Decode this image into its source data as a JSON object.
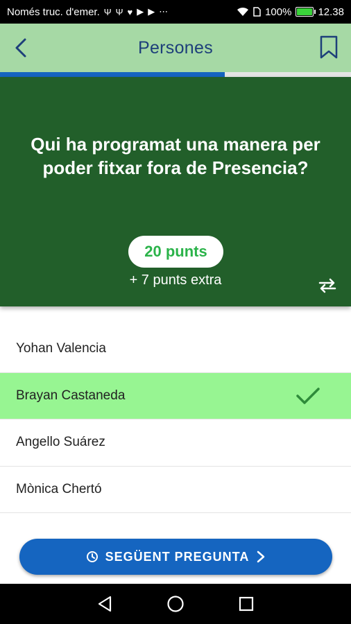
{
  "status_bar": {
    "left_text": "Només truc. d'emer.",
    "battery_percent": "100%",
    "time": "12.38"
  },
  "header": {
    "title": "Persones"
  },
  "progress": {
    "fraction": 0.64
  },
  "question": {
    "text": "Qui ha programat una manera per poder fitxar fora de Presencia?",
    "points": "20 punts",
    "extra_points": "+ 7 punts extra"
  },
  "answers": [
    {
      "label": "Yohan Valencia",
      "correct": false
    },
    {
      "label": "Brayan Castaneda",
      "correct": true
    },
    {
      "label": "Angello Suárez",
      "correct": false
    },
    {
      "label": "Mònica Chertó",
      "correct": false
    }
  ],
  "next_button": {
    "label": "SEGÜENT PREGUNTA"
  },
  "colors": {
    "header_bg": "#a6d9a5",
    "card_bg": "#225f2a",
    "accent_blue": "#1565c0",
    "correct_bg": "#97f592",
    "correct_check": "#2e8b3a"
  },
  "icons": {
    "back": "chevron-left-icon",
    "bookmark": "bookmark-icon",
    "swap": "swap-icon",
    "check": "check-icon",
    "clock": "clock-icon",
    "chevron_right": "chevron-right-icon",
    "nav_back": "triangle-back-icon",
    "nav_home": "circle-home-icon",
    "nav_recents": "square-recents-icon"
  }
}
